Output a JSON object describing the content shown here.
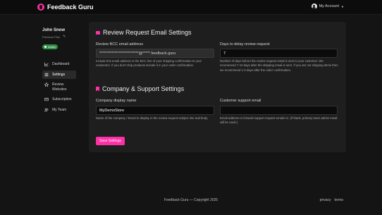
{
  "brand": {
    "name": "Feedback Guru",
    "accent": "#ff2fa6"
  },
  "account": {
    "label": "My Account",
    "icon": "user-circle-icon"
  },
  "user": {
    "name": "John Snow",
    "plan": "Premium Plan",
    "status": "Active"
  },
  "nav": [
    {
      "label": "Dashboard",
      "icon": "chart-icon",
      "active": false
    },
    {
      "label": "Settings",
      "icon": "sliders-icon",
      "active": true
    },
    {
      "label": "Review Websites",
      "icon": "star-icon",
      "active": false
    },
    {
      "label": "Subscription",
      "icon": "card-icon",
      "active": false
    },
    {
      "label": "My Team",
      "icon": "users-icon",
      "active": false
    }
  ],
  "review_section": {
    "title": "Review Request Email Settings",
    "bcc_label": "Review BCC email address",
    "bcc_value": "**************************@*****.feedback.guru",
    "bcc_help": "Include this email address in the BCC line of your shipping confirmation to your customers. If you don't ship products include it in your order confirmation.",
    "delay_label": "Days to delay review request",
    "delay_value": "7",
    "delay_help": "Number of days before the review request email is sent to your customer. We recommend 7-10 days after the shipping email is sent. If you are not shipping items then we recommend 1-3 days after the order confirmation."
  },
  "company_section": {
    "title": "Company & Support Settings",
    "name_label": "Company display name",
    "name_value": "MyDemoStore",
    "name_help": "Name of the company / brand to display in the review request subject line and body.",
    "email_label": "Customer support email",
    "email_value": "",
    "email_help": "Email address to forward support request emails to. (If blank, primary team admin email will be used.)"
  },
  "save_label": "Save Settings",
  "footer": {
    "copyright": "Feedback Guru — Copyright 2025",
    "privacy": "privacy",
    "terms": "terms"
  }
}
